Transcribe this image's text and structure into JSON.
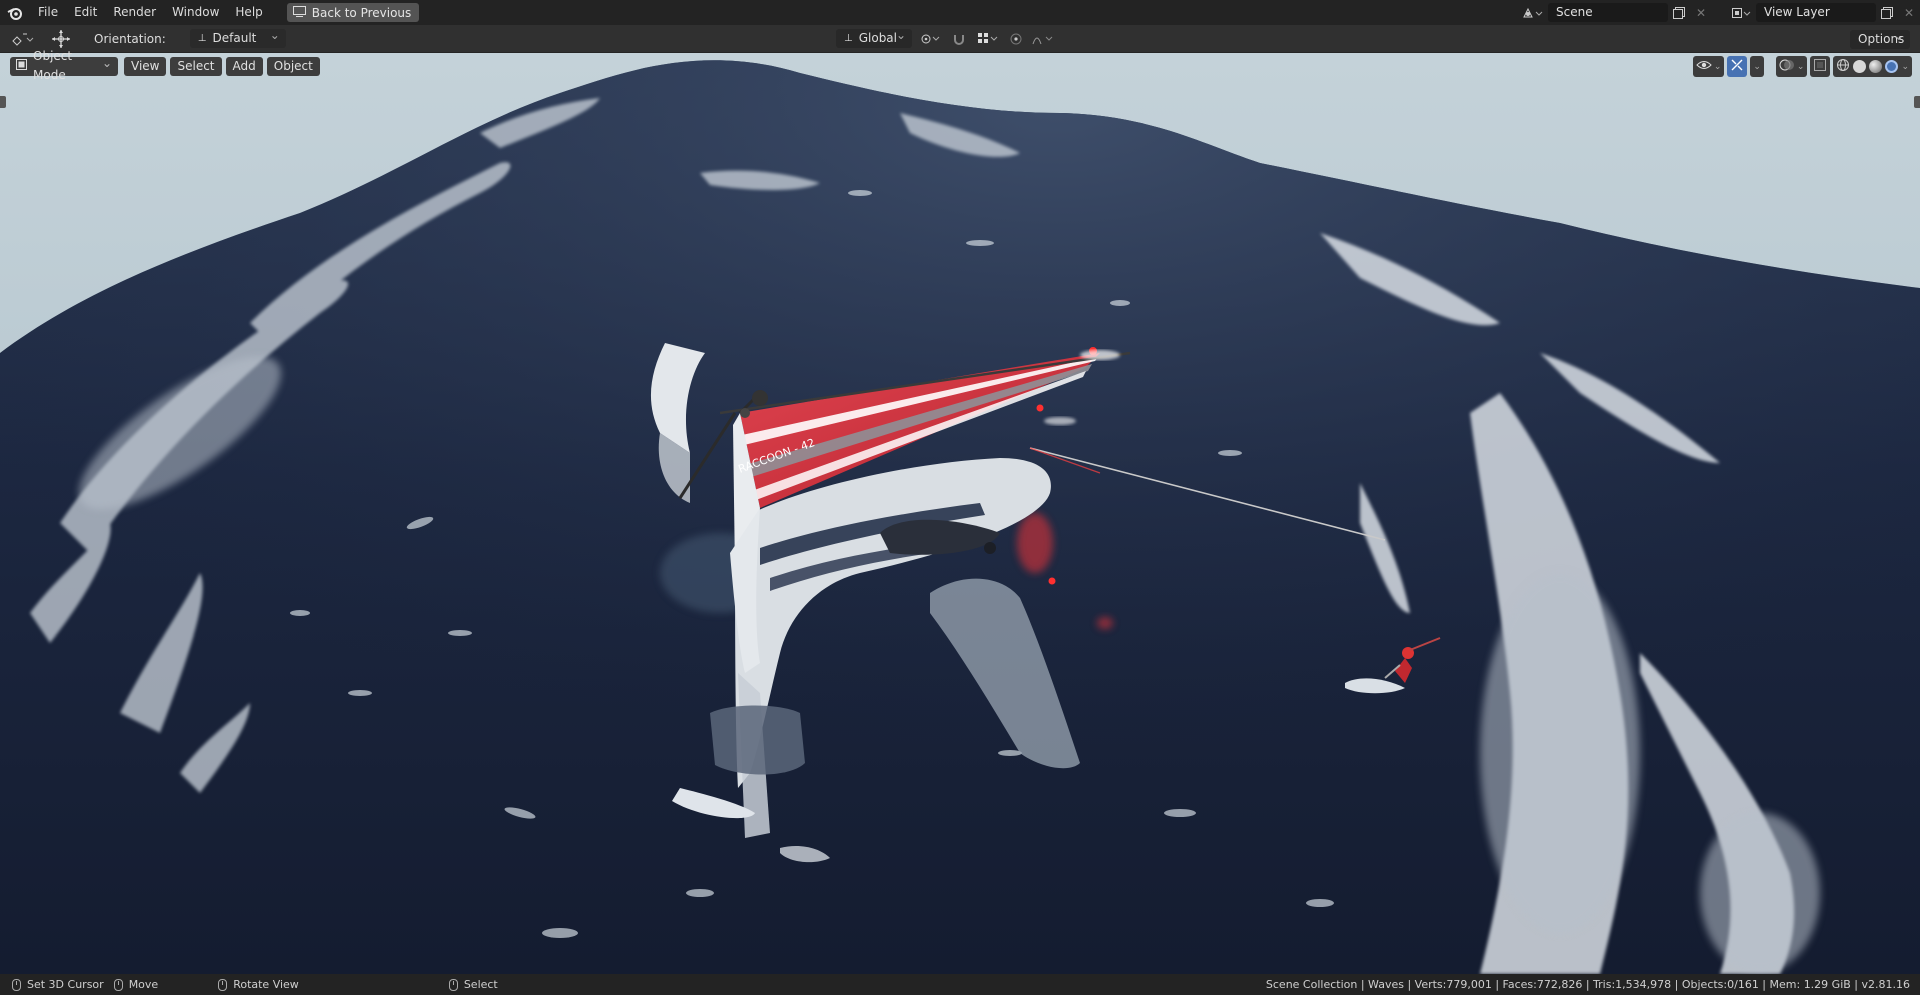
{
  "menubar": {
    "items": [
      "File",
      "Edit",
      "Render",
      "Window",
      "Help"
    ],
    "back_button": "Back to Previous",
    "scene_name": "Scene",
    "view_layer": "View Layer"
  },
  "toolbar": {
    "orientation_label": "Orientation:",
    "orientation_value": "Default",
    "transform_orientation": "Global",
    "options_label": "Options"
  },
  "viewport_header": {
    "mode": "Object Mode",
    "menus": [
      "View",
      "Select",
      "Add",
      "Object"
    ]
  },
  "scene": {
    "sail_text": "RACCOON - 42",
    "colors": {
      "sky": "#b9c9d1",
      "water": "#1e2940",
      "foam": "#cfd6de",
      "sail_red": "#d5303b",
      "hull": "#d8dde2"
    }
  },
  "statusbar": {
    "left_click": "Set 3D Cursor",
    "middle_click": "Move",
    "right_drag": "Rotate View",
    "right_click": "Select",
    "stats": "Scene Collection | Waves | Verts:779,001 | Faces:772,826 | Tris:1,534,978 | Objects:0/161 | Mem: 1.29 GiB | v2.81.16"
  }
}
